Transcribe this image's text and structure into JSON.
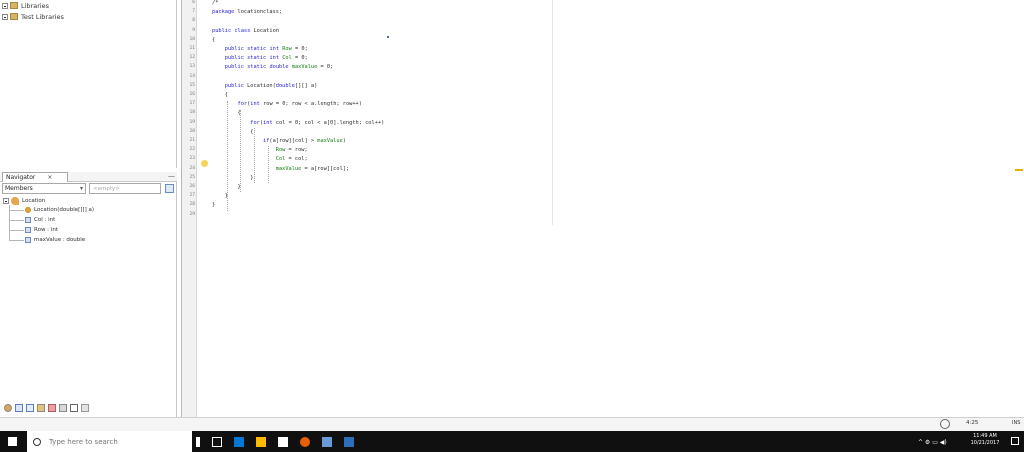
{
  "projects_panel": {
    "items": [
      {
        "label": "Libraries"
      },
      {
        "label": "Test Libraries"
      }
    ]
  },
  "navigator": {
    "tab_label": "Navigator",
    "close_symbol": "×",
    "minimize_symbol": "—",
    "filter": {
      "selected": "Members",
      "category_placeholder": "<empty>"
    },
    "tree": [
      {
        "label": "Location"
      },
      {
        "label": "Location(double[][] a)"
      },
      {
        "label": "Col : int"
      },
      {
        "label": "Row : int"
      },
      {
        "label": "maxValue : double"
      }
    ]
  },
  "editor": {
    "line_numbers": [
      "6",
      "7",
      "8",
      "9",
      "10",
      "11",
      "12",
      "13",
      "14",
      "15",
      "16",
      "17",
      "18",
      "19",
      "20",
      "21",
      "22",
      "23",
      "24",
      "25",
      "26",
      "27",
      "28",
      "29"
    ],
    "code": [
      "/*",
      "package locationclass;",
      "",
      "public class Location",
      "{",
      "    public static int Row = 0;",
      "    public static int Col = 0;",
      "    public static double maxValue = 0;",
      "",
      "    public Location(double[][] a)",
      "    {",
      "        for(int row = 0; row < a.length; row++)",
      "        {",
      "            for(int col = 0; col < a[0].length; col++)",
      "            {",
      "                if(a[row][col] > maxValue)",
      "                    Row = row;",
      "                    Col = col;",
      "                    maxValue = a[row][col];",
      "            }",
      "        }",
      "    }",
      "}",
      ""
    ]
  },
  "status_bar": {
    "position": "4:25",
    "mode": "INS"
  },
  "taskbar": {
    "search_placeholder": "Type here to search",
    "time": "11:49 AM",
    "date": "10/21/2017",
    "tray_text": "^ ⚙ ▭ ◀)"
  }
}
